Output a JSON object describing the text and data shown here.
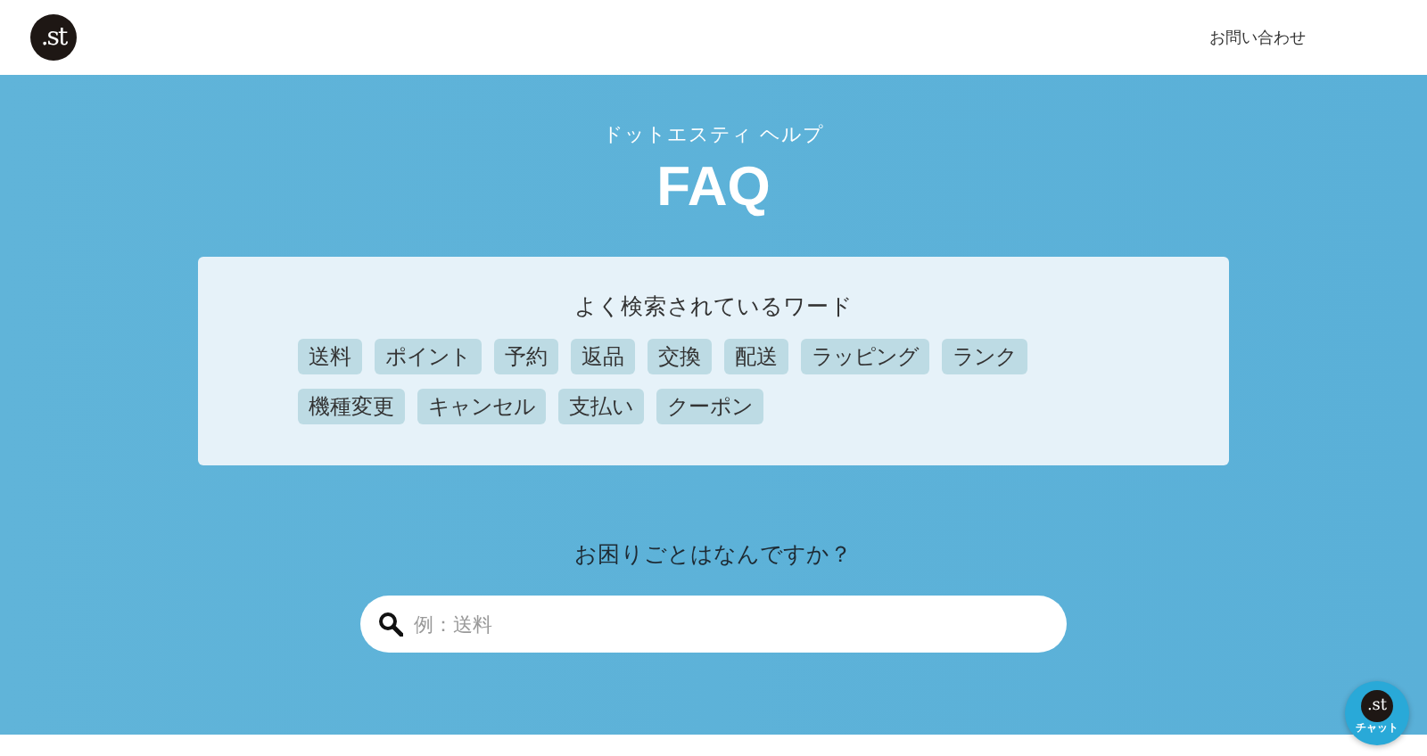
{
  "header": {
    "logo": ".st",
    "contact_link": "お問い合わせ"
  },
  "hero": {
    "subtitle": "ドットエスティ ヘルプ",
    "title": "FAQ"
  },
  "popular": {
    "title": "よく検索されているワード",
    "tags": [
      {
        "label": "送料"
      },
      {
        "label": "ポイント"
      },
      {
        "label": "予約"
      },
      {
        "label": "返品"
      },
      {
        "label": "交換"
      },
      {
        "label": "配送"
      },
      {
        "label": "ラッピング"
      },
      {
        "label": "ランク"
      },
      {
        "label": "機種変更"
      },
      {
        "label": "キャンセル"
      },
      {
        "label": "支払い"
      },
      {
        "label": "クーポン"
      }
    ]
  },
  "search": {
    "question": "お困りごとはなんですか？",
    "placeholder": "例：送料"
  },
  "chat_button": {
    "logo": ".st",
    "label": "チャット"
  }
}
